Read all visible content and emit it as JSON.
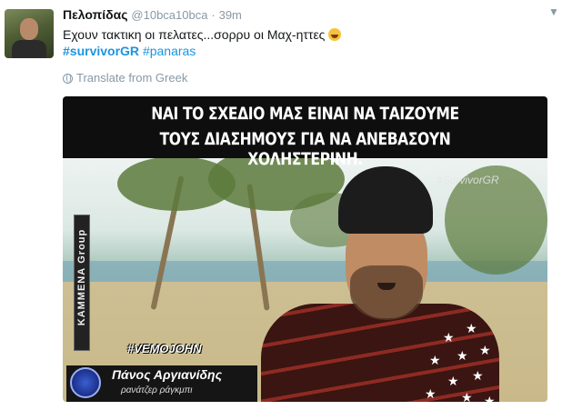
{
  "tweet": {
    "display_name": "Πελοπίδας",
    "handle": "@10bca10bca",
    "separator": "·",
    "time": "39m",
    "text": "Εχουν τακτικη οι πελατες...σορρυ οι Μαχ-ηττες",
    "emoji": "laughing-crying-emoji",
    "hashtags": [
      "#survivorGR",
      "#panaras"
    ],
    "translate_label": "Translate from Greek",
    "caret_icon": "chevron-down-icon"
  },
  "media": {
    "caption_line1": "ΝΑΙ ΤΟ ΣΧΕΔΙΟ ΜΑΣ ΕΙΝΑΙ ΝΑ ΤΑΙΖΟΥΜΕ",
    "caption_line2": "ΤΟΥΣ ΔΙΑΣΗΜΟΥΣ ΓΙΑ ΝΑ ΑΝΕΒΑΣΟΥΝ ΧΟΛΗΣΤΕΡΙΝΗ.",
    "watermark": "#SurvivorGR",
    "side_logo": "ΚΑΜΜΕΝΑ Group",
    "tag_overlay": "#VEMOJOHN",
    "person_name": "Πάνος Αργιανίδης",
    "person_subtitle": "ρανάτζερ ράγκμπι",
    "colors": {
      "caption_bg": "#0e0e0e",
      "shirt": "#3a1512",
      "hat": "#1c1c1c"
    }
  },
  "colors": {
    "link": "#1b95e0",
    "muted": "#8899a6",
    "text": "#14171a"
  }
}
